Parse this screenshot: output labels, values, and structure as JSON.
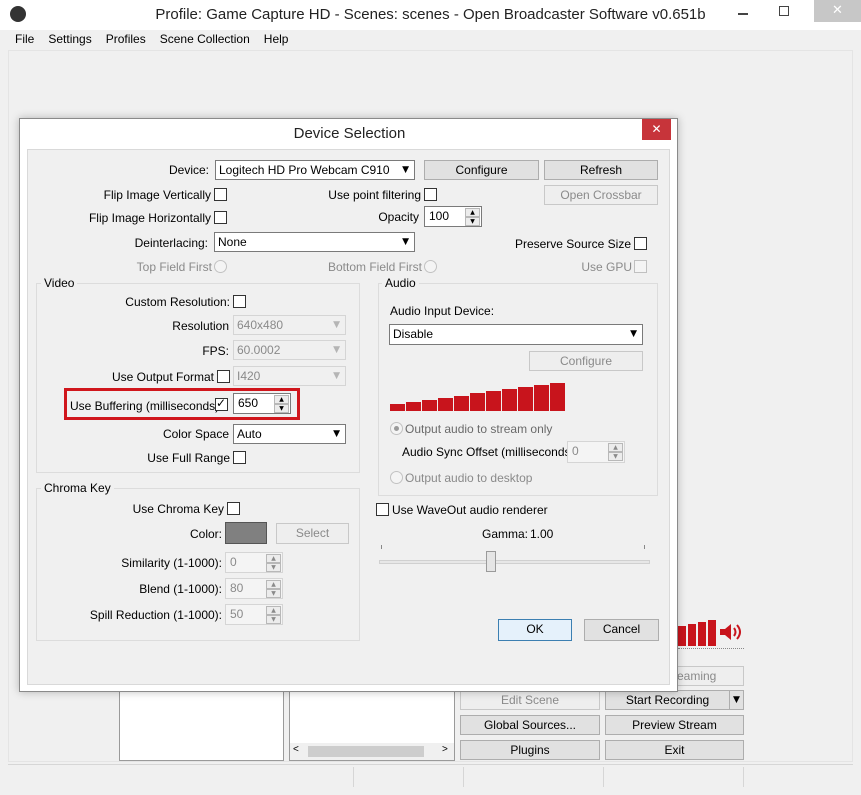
{
  "main_window": {
    "title": "Profile: Game Capture HD - Scenes: scenes - Open Broadcaster Software v0.651b",
    "menu": [
      "File",
      "Settings",
      "Profiles",
      "Scene Collection",
      "Help"
    ],
    "buttons": {
      "edit_scene": "Edit Scene",
      "start_recording": "Start Recording",
      "global_sources": "Global Sources...",
      "preview_stream": "Preview Stream",
      "plugins": "Plugins",
      "exit": "Exit",
      "streaming_partial": "eaming"
    }
  },
  "dialog": {
    "title": "Device Selection",
    "device_label": "Device:",
    "device_value": "Logitech HD Pro Webcam C910",
    "configure": "Configure",
    "refresh": "Refresh",
    "flip_v": "Flip Image Vertically",
    "use_point_filtering": "Use point filtering",
    "open_crossbar": "Open Crossbar",
    "flip_h": "Flip Image Horizontally",
    "opacity_label": "Opacity",
    "opacity_value": "100",
    "deinterlacing_label": "Deinterlacing:",
    "deinterlacing_value": "None",
    "preserve_source_size": "Preserve Source Size",
    "top_field_first": "Top Field First",
    "bottom_field_first": "Bottom Field First",
    "use_gpu": "Use GPU",
    "video": {
      "title": "Video",
      "custom_resolution": "Custom Resolution:",
      "resolution_label": "Resolution",
      "resolution_value": "640x480",
      "fps_label": "FPS:",
      "fps_value": "60.0002",
      "use_output_format": "Use Output Format",
      "output_format_value": "I420",
      "use_buffering": "Use Buffering (milliseconds):",
      "buffering_value": "650",
      "color_space_label": "Color Space",
      "color_space_value": "Auto",
      "use_full_range": "Use Full Range"
    },
    "audio": {
      "title": "Audio",
      "input_device_label": "Audio Input Device:",
      "input_device_value": "Disable",
      "configure": "Configure",
      "output_to_stream": "Output audio to stream only",
      "sync_offset_label": "Audio Sync Offset (milliseconds):",
      "sync_offset_value": "0",
      "output_to_desktop": "Output audio to desktop",
      "meter_levels": [
        0.19,
        0.25,
        0.31,
        0.38,
        0.44,
        0.5,
        0.56,
        0.63,
        0.69,
        0.75,
        0.8
      ]
    },
    "use_waveout": "Use WaveOut audio renderer",
    "gamma_label": "Gamma:",
    "gamma_value": "1.00",
    "gamma_slider": 0.41,
    "chroma": {
      "title": "Chroma Key",
      "use_chroma_key": "Use Chroma Key",
      "color_label": "Color:",
      "select": "Select",
      "similarity_label": "Similarity (1-1000):",
      "similarity_value": "0",
      "blend_label": "Blend (1-1000):",
      "blend_value": "80",
      "spill_label": "Spill Reduction (1-1000):",
      "spill_value": "50"
    },
    "ok": "OK",
    "cancel": "Cancel"
  },
  "colors": {
    "highlight": "#d0161c",
    "meter": "#c8141c",
    "chroma_swatch": "#808080"
  }
}
